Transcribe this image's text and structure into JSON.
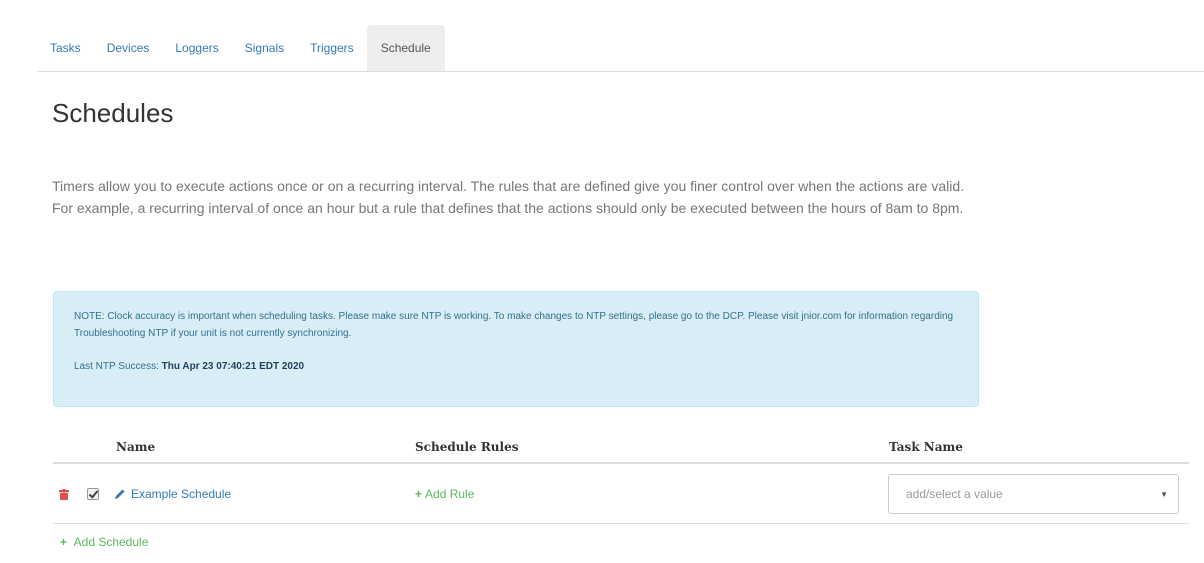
{
  "tabs": [
    {
      "label": "Tasks",
      "active": false
    },
    {
      "label": "Devices",
      "active": false
    },
    {
      "label": "Loggers",
      "active": false
    },
    {
      "label": "Signals",
      "active": false
    },
    {
      "label": "Triggers",
      "active": false
    },
    {
      "label": "Schedule",
      "active": true
    }
  ],
  "page": {
    "title": "Schedules",
    "intro": "Timers allow you to execute actions once or on a recurring interval. The rules that are defined give you finer control over when the actions are valid. For example, a recurring interval of once an hour but a rule that defines that the actions should only be executed between the hours of 8am to 8pm."
  },
  "note": {
    "text": "NOTE: Clock accuracy is important when scheduling tasks. Please make sure NTP is working. To make changes to NTP settings, please go to the DCP. Please visit jnior.com for information regarding Troubleshooting NTP if your unit is not currently synchronizing.",
    "ntp_label": "Last NTP Success:",
    "ntp_value": "Thu Apr 23 07:40:21 EDT 2020"
  },
  "table": {
    "headers": {
      "name": "Name",
      "rules": "Schedule Rules",
      "task": "Task Name"
    },
    "rows": [
      {
        "name": "Example Schedule",
        "add_rule": "Add Rule",
        "task_placeholder": "add/select a value"
      }
    ],
    "add_schedule": "Add Schedule"
  },
  "colors": {
    "link": "#337ab7",
    "success": "#5cb85c",
    "danger": "#d9534f",
    "info_bg": "#d9edf7"
  },
  "icons": {
    "delete": "trash-icon",
    "enabled": "checkbox-icon",
    "edit": "pencil-icon",
    "add": "plus-icon",
    "dropdown": "caret-down-icon"
  }
}
